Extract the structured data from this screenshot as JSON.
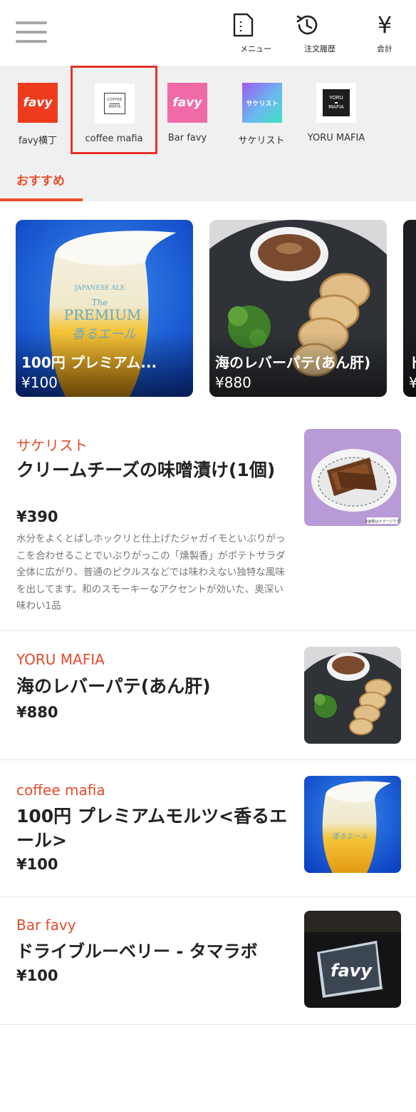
{
  "header": {
    "menu_label": "メニュー",
    "history_label": "注文履歴",
    "bill_label": "会計",
    "yen_symbol": "¥"
  },
  "shops": [
    {
      "name": "favy横丁",
      "logo_text": "favy"
    },
    {
      "name": "coffee mafia",
      "logo_lines": [
        "COFFEE",
        "MAFIA"
      ]
    },
    {
      "name": "Bar favy",
      "logo_text": "favy"
    },
    {
      "name": "サケリスト",
      "logo_text": "サケリスト"
    },
    {
      "name": "YORU MAFIA",
      "logo_lines": [
        "YORU",
        "MAFIA"
      ]
    }
  ],
  "selected_shop": "coffee mafia",
  "tabs": [
    {
      "label": "おすすめ",
      "active": true
    }
  ],
  "recommend": [
    {
      "name": "100円 プレミアム...",
      "price": "¥100"
    },
    {
      "name": "海のレバーパテ(あん肝)",
      "price": "¥880"
    },
    {
      "name": "ド",
      "price": "¥"
    }
  ],
  "items": [
    {
      "shop": "サケリスト",
      "title": "クリームチーズの味噌漬け(1個)",
      "price": "¥390",
      "description": "水分をよくとばしホックリと仕上げたジャガイモといぶりがっこを合わせることでいぶりがっこの「燻製香」がポテトサラダ全体に広がり、普通のピクルスなどでは味わえない独特な風味を出してます。和のスモーキーなアクセントが効いた、奥深い味わい1品",
      "image_note": "※画像はイメージです"
    },
    {
      "shop": "YORU MAFIA",
      "title": "海のレバーパテ(あん肝)",
      "price": "¥880"
    },
    {
      "shop": "coffee mafia",
      "title": "100円 プレミアムモルツ<香るエール>",
      "price": "¥100"
    },
    {
      "shop": "Bar favy",
      "title": "ドライブルーベリー - タマラボ",
      "price": "¥100",
      "image_sign": "favy"
    }
  ],
  "colors": {
    "accent": "#ea4d2c",
    "favy_red": "#ee3b1e",
    "favy_pink": "#f06aa8",
    "selection_border": "#e8312a"
  }
}
